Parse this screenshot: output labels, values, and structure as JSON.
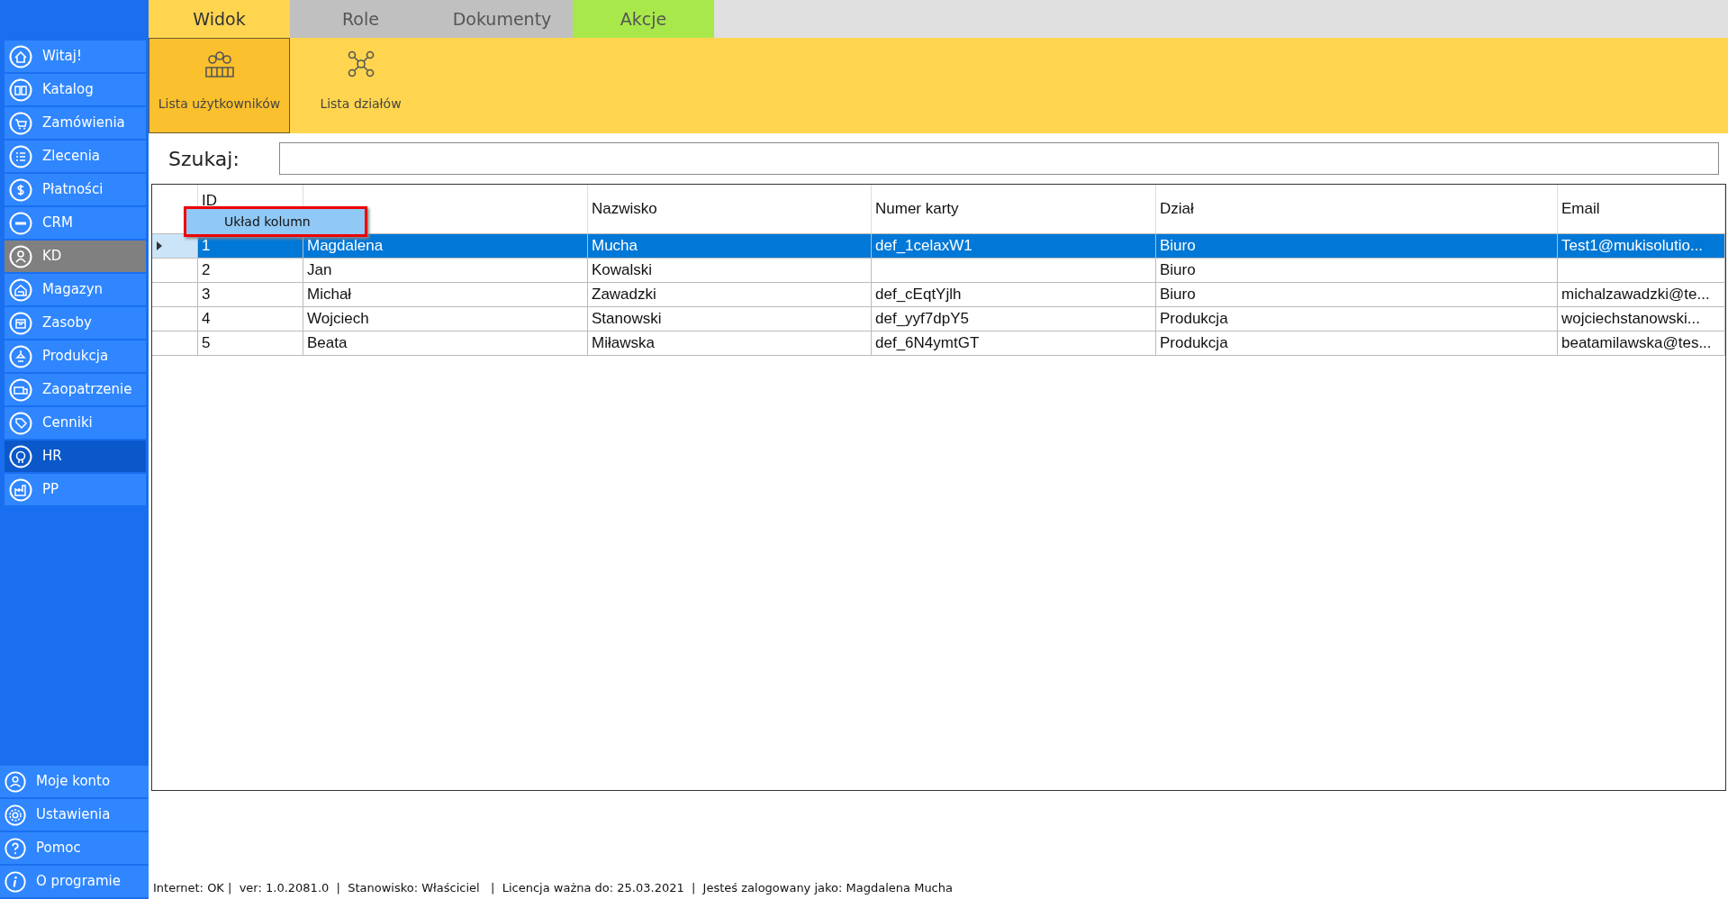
{
  "sidebar": {
    "items": [
      {
        "label": "Witaj!",
        "selected": false,
        "hovered": false
      },
      {
        "label": "Katalog",
        "selected": false,
        "hovered": false
      },
      {
        "label": "Zamówienia",
        "selected": false,
        "hovered": false
      },
      {
        "label": "Zlecenia",
        "selected": false,
        "hovered": false
      },
      {
        "label": "Płatności",
        "selected": false,
        "hovered": false
      },
      {
        "label": "CRM",
        "selected": false,
        "hovered": false
      },
      {
        "label": "KD",
        "selected": true,
        "hovered": false
      },
      {
        "label": "Magazyn",
        "selected": false,
        "hovered": false
      },
      {
        "label": "Zasoby",
        "selected": false,
        "hovered": false
      },
      {
        "label": "Produkcja",
        "selected": false,
        "hovered": false
      },
      {
        "label": "Zaopatrzenie",
        "selected": false,
        "hovered": false
      },
      {
        "label": "Cenniki",
        "selected": false,
        "hovered": false
      },
      {
        "label": "HR",
        "selected": false,
        "hovered": true
      },
      {
        "label": "PP",
        "selected": false,
        "hovered": false
      }
    ],
    "bottom_items": [
      {
        "label": "Moje konto"
      },
      {
        "label": "Ustawienia"
      },
      {
        "label": "Pomoc"
      },
      {
        "label": "O programie"
      }
    ]
  },
  "tabs": [
    {
      "label": "Widok",
      "selected": true,
      "color": "#ffd54f"
    },
    {
      "label": "Role",
      "selected": false,
      "color": "#c0c0c0"
    },
    {
      "label": "Dokumenty",
      "selected": false,
      "color": "#c0c0c0"
    },
    {
      "label": "Akcje",
      "selected": false,
      "color": "#a8e84a"
    }
  ],
  "toolbar": [
    {
      "label": "Lista użytkowników",
      "selected": true
    },
    {
      "label": "Lista działów",
      "selected": false
    }
  ],
  "search": {
    "label": "Szukaj:"
  },
  "table": {
    "columns": [
      {
        "label": "ID"
      },
      {},
      {
        "label": "Nazwisko"
      },
      {
        "label": "Numer karty"
      },
      {
        "label": "Dział"
      },
      {
        "label": "Email"
      }
    ],
    "rows": [
      {
        "selected": true,
        "cells": [
          "1",
          "Magdalena",
          "Mucha",
          "def_1celaxW1",
          "Biuro",
          "Test1@mukisolutio..."
        ]
      },
      {
        "selected": false,
        "cells": [
          "2",
          "Jan",
          "Kowalski",
          "",
          "Biuro",
          ""
        ]
      },
      {
        "selected": false,
        "cells": [
          "3",
          "Michał",
          "Zawadzki",
          "def_cEqtYjlh",
          "Biuro",
          "michalzawadzki@te..."
        ]
      },
      {
        "selected": false,
        "cells": [
          "4",
          "Wojciech",
          "Stanowski",
          "def_yyf7dpY5",
          "Produkcja",
          "wojciechstanowski..."
        ]
      },
      {
        "selected": false,
        "cells": [
          "5",
          "Beata",
          "Miławska",
          "def_6N4ymtGT",
          "Produkcja",
          "beatamilawska@tes..."
        ]
      }
    ]
  },
  "context_menu": {
    "items": [
      "Układ kolumn"
    ]
  },
  "status_bar": "Internet: OK |  ver: 1.0.2081.0  |  Stanowisko: Właściciel   |  Licencja ważna do: 25.03.2021  |  Jesteś zalogowany jako: Magdalena Mucha"
}
